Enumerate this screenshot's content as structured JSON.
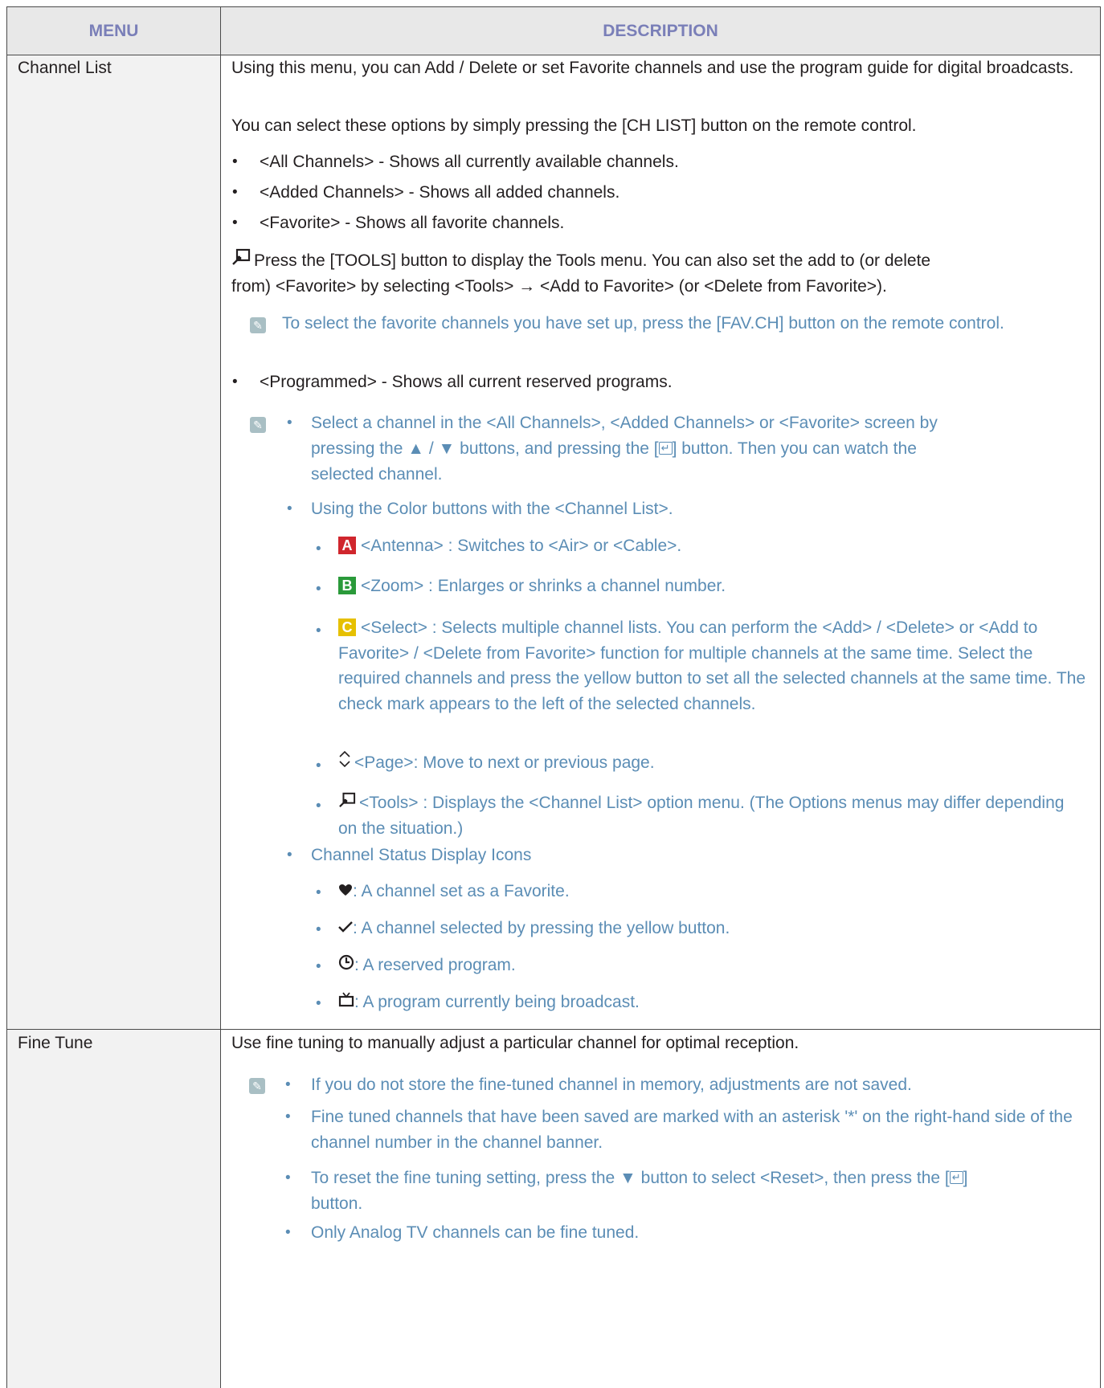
{
  "header": {
    "menu": "MENU",
    "description": "DESCRIPTION"
  },
  "channel_list": {
    "name": "Channel List",
    "intro": "Using this menu, you can Add / Delete or set Favorite channels and use the program guide for digital broadcasts.",
    "select_options": "You can select these options by simply pressing the [CH LIST] button on the remote control.",
    "all_channels": "<All Channels> - Shows all currently available channels.",
    "added_channels": "<Added Channels> - Shows all added channels.",
    "favorite": "<Favorite> - Shows all favorite channels.",
    "tools_note_line1": "Press the [TOOLS] button to display the Tools menu. You can also set the add to (or delete",
    "tools_note_line2": "from) <Favorite> by selecting <Tools> → <Add to Favorite> (or <Delete from Favorite>).",
    "fav_note": "To select the favorite channels you have set up, press the [FAV.CH] button on the remote control.",
    "programmed": "<Programmed> - Shows all current reserved programs.",
    "select_channel_line1": "Select a channel in the <All Channels>, <Added Channels> or <Favorite> screen by",
    "select_channel_line2a": "pressing the ▲ / ▼ buttons, and pressing the [",
    "select_channel_line2b": "] button. Then you can watch the",
    "select_channel_line3": "selected channel.",
    "color_buttons": "Using the Color buttons with the <Channel List>.",
    "btn_a_label": "A",
    "btn_a": "<Antenna> : Switches to <Air> or <Cable>.",
    "btn_b_label": "B",
    "btn_b": "<Zoom> : Enlarges or shrinks a channel number.",
    "btn_c_label": "C",
    "btn_c": "<Select> : Selects multiple channel lists. You can perform the <Add> / <Delete> or <Add to Favorite> / <Delete from Favorite> function for multiple channels at the same time. Select the required channels and press the yellow button to set all the selected channels at the same time. The check mark appears to the left of the selected channels.",
    "page": "<Page>: Move to next or previous page.",
    "tools": "<Tools> : Displays the <Channel List> option menu. (The Options menus may differ depending on the situation.)",
    "status_icons": "Channel Status Display Icons",
    "icon_fav": ": A channel set as a Favorite.",
    "icon_check": ": A channel selected by pressing the yellow button.",
    "icon_clock": ": A reserved program.",
    "icon_tv": ": A program currently being broadcast."
  },
  "fine_tune": {
    "name": "Fine Tune",
    "intro": "Use fine tuning to manually adjust a particular channel for optimal reception.",
    "note1": "If you do not store the fine-tuned channel in memory, adjustments are not saved.",
    "note2": "Fine tuned channels that have been saved are marked with an asterisk '*' on the right-hand side of the channel number in the channel banner.",
    "note3a": "To reset the fine tuning setting, press the ▼ button to select <Reset>, then press the [",
    "note3b": "]",
    "note3c": "button.",
    "note4": "Only Analog TV channels can be fine tuned."
  },
  "colors": {
    "accent_blue": "#5b8db5",
    "header_text": "#7a7fb8",
    "btn_a": "#d0262d",
    "btn_b": "#2a9a3a",
    "btn_c": "#e6c000"
  },
  "icons": [
    "tools-icon",
    "note-icon",
    "enter-icon",
    "page-icon",
    "heart-icon",
    "check-icon",
    "clock-icon",
    "tv-icon"
  ]
}
